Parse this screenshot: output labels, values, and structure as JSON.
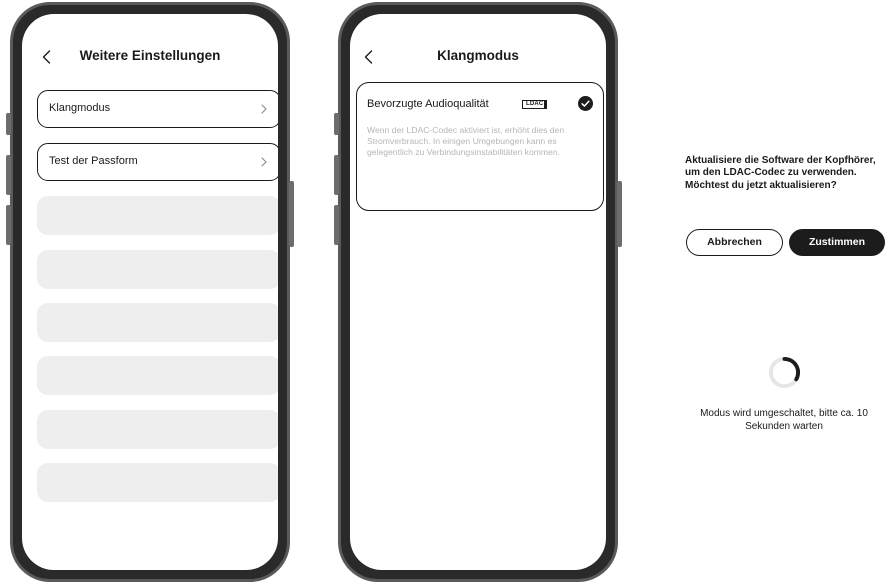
{
  "settings_screen": {
    "title": "Weitere Einstellungen",
    "back_icon": "chevron-left-icon",
    "items": [
      {
        "label": "Klangmodus",
        "icon": "chevron-right-icon"
      },
      {
        "label": "Test der Passform",
        "icon": "chevron-right-icon"
      }
    ],
    "placeholder_count": 6
  },
  "sound_mode_screen": {
    "title": "Klangmodus",
    "back_icon": "chevron-left-icon",
    "option": {
      "label": "Bevorzugte Audioqualität",
      "badge": "LDAC",
      "selected": true,
      "description": "Wenn der LDAC-Codec aktiviert ist, erhöht dies den Stromverbrauch. In einigen Umgebungen kann es gelegentlich zu Verbindungsinstabilitäten kommen."
    }
  },
  "update_dialog": {
    "message": "Aktualisiere die Software der Kopfhörer, um den LDAC-Codec zu verwenden. Möchtest du jetzt aktualisieren?",
    "cancel_label": "Abbrechen",
    "confirm_label": "Zustimmen"
  },
  "switching": {
    "spinner_icon": "loading-spinner-icon",
    "message": "Modus wird umgeschaltet, bitte ca. 10 Sekunden warten"
  },
  "colors": {
    "dark": "#1c1c1c",
    "placeholder": "#eeeeee",
    "muted_text": "#b6b6b6",
    "frame": "#2a2a2a"
  }
}
